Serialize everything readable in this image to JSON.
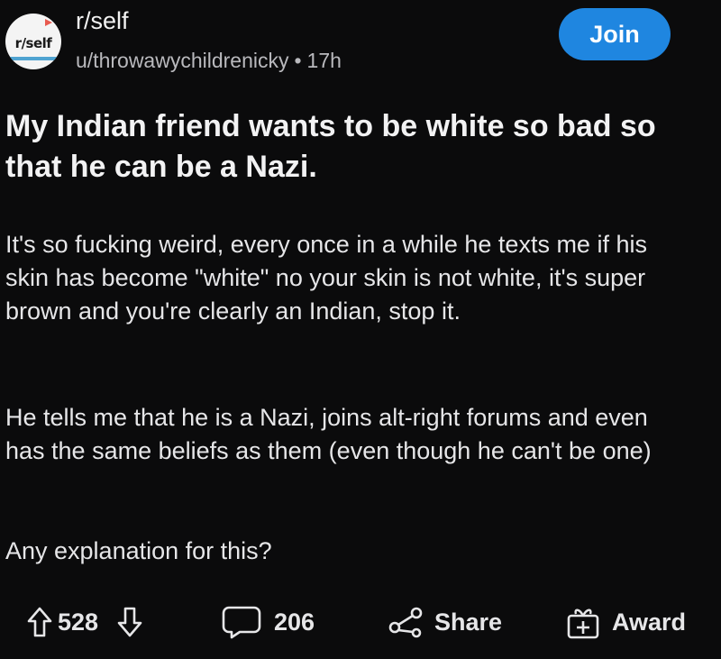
{
  "header": {
    "avatar_text": "r/self",
    "subreddit": "r/self",
    "author": "u/throwawychildrenicky",
    "separator": "•",
    "time": "17h",
    "join_label": "Join"
  },
  "post": {
    "title": "My Indian friend wants to be white so bad so that he can be a Nazi.",
    "paragraphs": [
      "It's so fucking weird, every once in a while he texts me if his skin has become \"white\" no your skin is not white, it's super brown and you're clearly an Indian, stop it.",
      "He tells me that he is a Nazi, joins alt-right forums and even has the same beliefs as them (even though he can't be one)",
      "Any explanation for this?"
    ]
  },
  "actions": {
    "upvote_icon": "arrow-up-icon",
    "vote_count": "528",
    "downvote_icon": "arrow-down-icon",
    "comment_icon": "comment-bubble-icon",
    "comment_count": "206",
    "share_icon": "share-icon",
    "share_label": "Share",
    "award_icon": "gift-box-icon",
    "award_label": "Award"
  },
  "colors": {
    "background": "#0b0b0c",
    "join_button": "#1f86e0",
    "text_primary": "#f2f2f3",
    "text_secondary": "#b9b9bd"
  }
}
